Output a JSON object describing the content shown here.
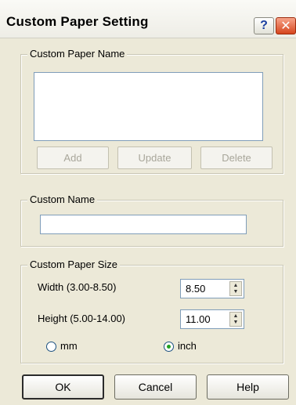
{
  "window": {
    "title": "Custom Paper Setting",
    "help_glyph": "?",
    "close_glyph": "✕"
  },
  "paper_name_group": {
    "legend": "Custom Paper Name",
    "list_items": [],
    "buttons": {
      "add": "Add",
      "update": "Update",
      "delete": "Delete"
    }
  },
  "custom_name_group": {
    "legend": "Custom Name",
    "value": ""
  },
  "paper_size_group": {
    "legend": "Custom Paper Size",
    "width": {
      "label": "Width (3.00-8.50)",
      "value": "8.50"
    },
    "height": {
      "label": "Height (5.00-14.00)",
      "value": "11.00"
    },
    "units": {
      "mm_label": "mm",
      "inch_label": "inch",
      "selected": "inch"
    }
  },
  "footer": {
    "ok": "OK",
    "cancel": "Cancel",
    "help": "Help"
  },
  "colors": {
    "dialog_bg": "#ece9d8",
    "close_red": "#d6461e",
    "radio_green": "#21a121",
    "field_border": "#7f9db9"
  }
}
